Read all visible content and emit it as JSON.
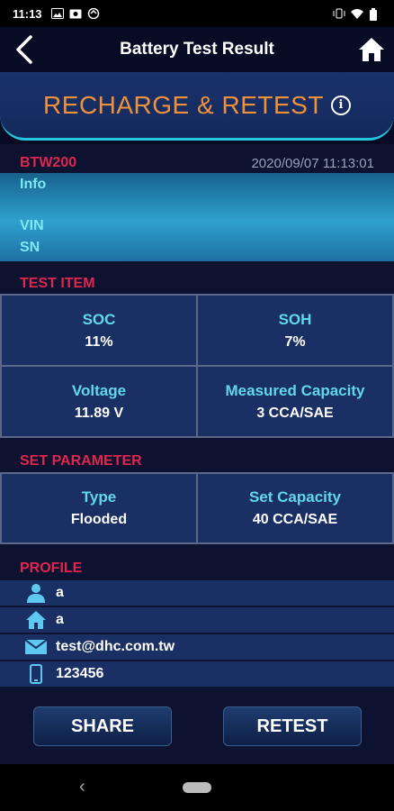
{
  "status_bar": {
    "time": "11:13",
    "left_icons": [
      "image-icon",
      "photo-icon",
      "sync-icon"
    ],
    "right_icons": [
      "vibrate-icon",
      "wifi-icon",
      "battery-icon"
    ]
  },
  "header": {
    "title": "Battery Test Result",
    "back_icon": "back-arrow-icon",
    "home_icon": "home-icon"
  },
  "result": {
    "text": "RECHARGE & RETEST",
    "info_glyph": "i",
    "color": "#f0913a"
  },
  "info": {
    "device": "BTW200",
    "datetime": "2020/09/07 11:13:01",
    "info_label": "Info",
    "vin_label": "VIN",
    "sn_label": "SN"
  },
  "test_item": {
    "title": "TEST ITEM",
    "cells": [
      {
        "label": "SOC",
        "value": "11%"
      },
      {
        "label": "SOH",
        "value": "7%"
      },
      {
        "label": "Voltage",
        "value": "11.89 V"
      },
      {
        "label": "Measured Capacity",
        "value": "3 CCA/SAE"
      }
    ]
  },
  "set_parameter": {
    "title": "SET PARAMETER",
    "cells": [
      {
        "label": "Type",
        "value": "Flooded"
      },
      {
        "label": "Set Capacity",
        "value": "40 CCA/SAE"
      }
    ]
  },
  "profile": {
    "title": "PROFILE",
    "rows": [
      {
        "icon": "person-icon",
        "value": "a"
      },
      {
        "icon": "house-icon",
        "value": "a"
      },
      {
        "icon": "mail-icon",
        "value": "test@dhc.com.tw"
      },
      {
        "icon": "phone-icon",
        "value": "123456"
      }
    ]
  },
  "actions": {
    "share_label": "SHARE",
    "retest_label": "RETEST"
  },
  "nav": {
    "back_glyph": "‹"
  },
  "colors": {
    "accent_cyan": "#25c7e0",
    "section_red": "#e0254f",
    "label_cyan": "#61d7ee",
    "result_orange": "#f0913a"
  }
}
